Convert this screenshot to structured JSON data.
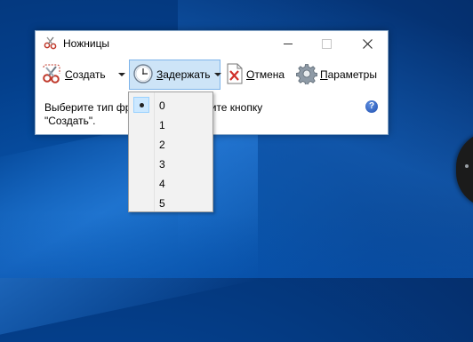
{
  "window": {
    "title": "Ножницы"
  },
  "toolbar": {
    "new_label_u": "С",
    "new_label_rest": "оздать",
    "delay_label_u": "З",
    "delay_label_rest": "адержать",
    "cancel_label_u": "О",
    "cancel_label_rest": "тмена",
    "options_label_u": "П",
    "options_label_rest": "араметры"
  },
  "content": {
    "hint_line1_left": "Выберите тип фр",
    "hint_line1_right": "или нажмите кнопку",
    "hint_line2": "\"Создать\"."
  },
  "delay_menu": {
    "items": [
      "0",
      "1",
      "2",
      "3",
      "4",
      "5"
    ],
    "selected": "0"
  },
  "icons": {
    "app": "scissors-icon",
    "new": "scissors-icon",
    "delay": "clock-icon",
    "cancel": "cancel-x-icon",
    "options": "gear-icon",
    "help": "help-icon"
  },
  "colors": {
    "desktop": "#0752a8",
    "delay_button_bg": "#cde4f7",
    "delay_button_border": "#7eb4ea",
    "menu_bg": "#f2f2f2",
    "menu_check_bg": "#cce8ff"
  }
}
